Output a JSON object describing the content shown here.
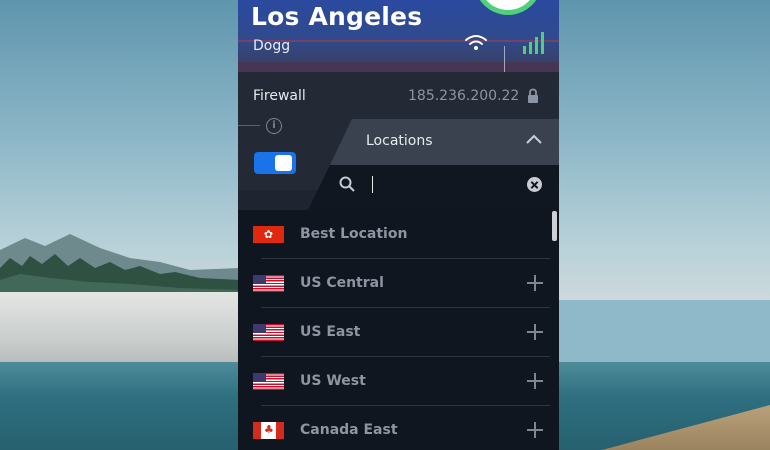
{
  "header": {
    "city": "Los Angeles",
    "server": "Dogg",
    "status_color": "#4fd07a"
  },
  "firewall": {
    "label": "Firewall",
    "ip": "185.236.200.22",
    "toggle_on": true,
    "accent": "#1a73e8"
  },
  "locations": {
    "title": "Locations",
    "search_value": "",
    "items": [
      {
        "label": "Best Location",
        "flag": "hong-kong-flag-icon",
        "expandable": false
      },
      {
        "label": "US Central",
        "flag": "us-flag-icon",
        "expandable": true
      },
      {
        "label": "US East",
        "flag": "us-flag-icon",
        "expandable": true
      },
      {
        "label": "US West",
        "flag": "us-flag-icon",
        "expandable": true
      },
      {
        "label": "Canada East",
        "flag": "canada-flag-icon",
        "expandable": true
      }
    ]
  },
  "icons": {
    "wifi": "wifi-icon",
    "signal": "signal-strength-icon",
    "lock": "lock-icon",
    "info": "info-icon",
    "chevron": "chevron-up-icon",
    "search": "search-icon",
    "clear": "clear-icon",
    "expand": "plus-icon"
  }
}
